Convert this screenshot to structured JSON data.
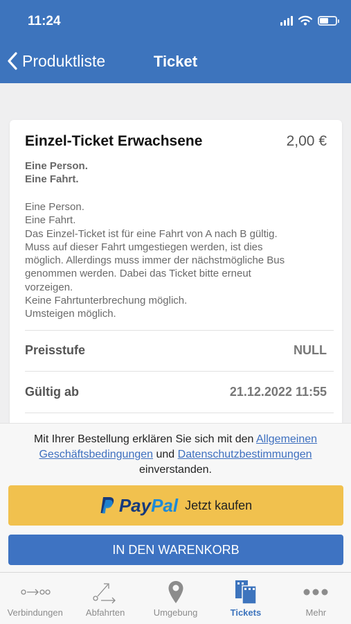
{
  "status_bar": {
    "time": "11:24"
  },
  "nav": {
    "back_label": "Produktliste",
    "title": "Ticket"
  },
  "ticket": {
    "title": "Einzel-Ticket Erwachsene",
    "price": "2,00 €",
    "summary_lines": [
      "Eine Person.",
      "Eine Fahrt."
    ],
    "description_lines": [
      "Eine Person.",
      "Eine Fahrt.",
      "Das Einzel-Ticket ist für eine Fahrt von A nach B gültig.",
      "Muss auf dieser Fahrt umgestiegen werden, ist dies",
      "möglich. Allerdings muss immer der nächstmögliche Bus",
      "genommen werden. Dabei das Ticket bitte erneut",
      "vorzeigen.",
      "Keine Fahrtunterbrechung möglich.",
      "Umsteigen möglich."
    ],
    "rows": [
      {
        "label": "Preisstufe",
        "value": "NULL"
      },
      {
        "label": "Gültig ab",
        "value": "21.12.2022 11:55"
      }
    ]
  },
  "terms": {
    "prefix": "Mit Ihrer Bestellung erklären Sie sich mit den ",
    "agb_link": "Allgemeinen Geschäftsbedingungen",
    "middle": " und ",
    "privacy_link": "Datenschutzbestimmungen",
    "suffix": " einverstanden."
  },
  "paypal_button": {
    "brand_part1": "Pay",
    "brand_part2": "Pal",
    "label": "Jetzt kaufen"
  },
  "cart_button": {
    "label": "IN DEN WARENKORB"
  },
  "tabbar": {
    "active_index": 3,
    "items": [
      {
        "label": "Verbindungen",
        "icon": "connections-icon"
      },
      {
        "label": "Abfahrten",
        "icon": "departures-icon"
      },
      {
        "label": "Umgebung",
        "icon": "location-pin-icon"
      },
      {
        "label": "Tickets",
        "icon": "tickets-icon"
      },
      {
        "label": "Mehr",
        "icon": "more-icon"
      }
    ]
  },
  "colors": {
    "primary": "#3d74bd",
    "paypal_yellow": "#f1c14e",
    "paypal_dark": "#163a7c",
    "paypal_light": "#1e8ad6",
    "link": "#3d6fbf"
  }
}
